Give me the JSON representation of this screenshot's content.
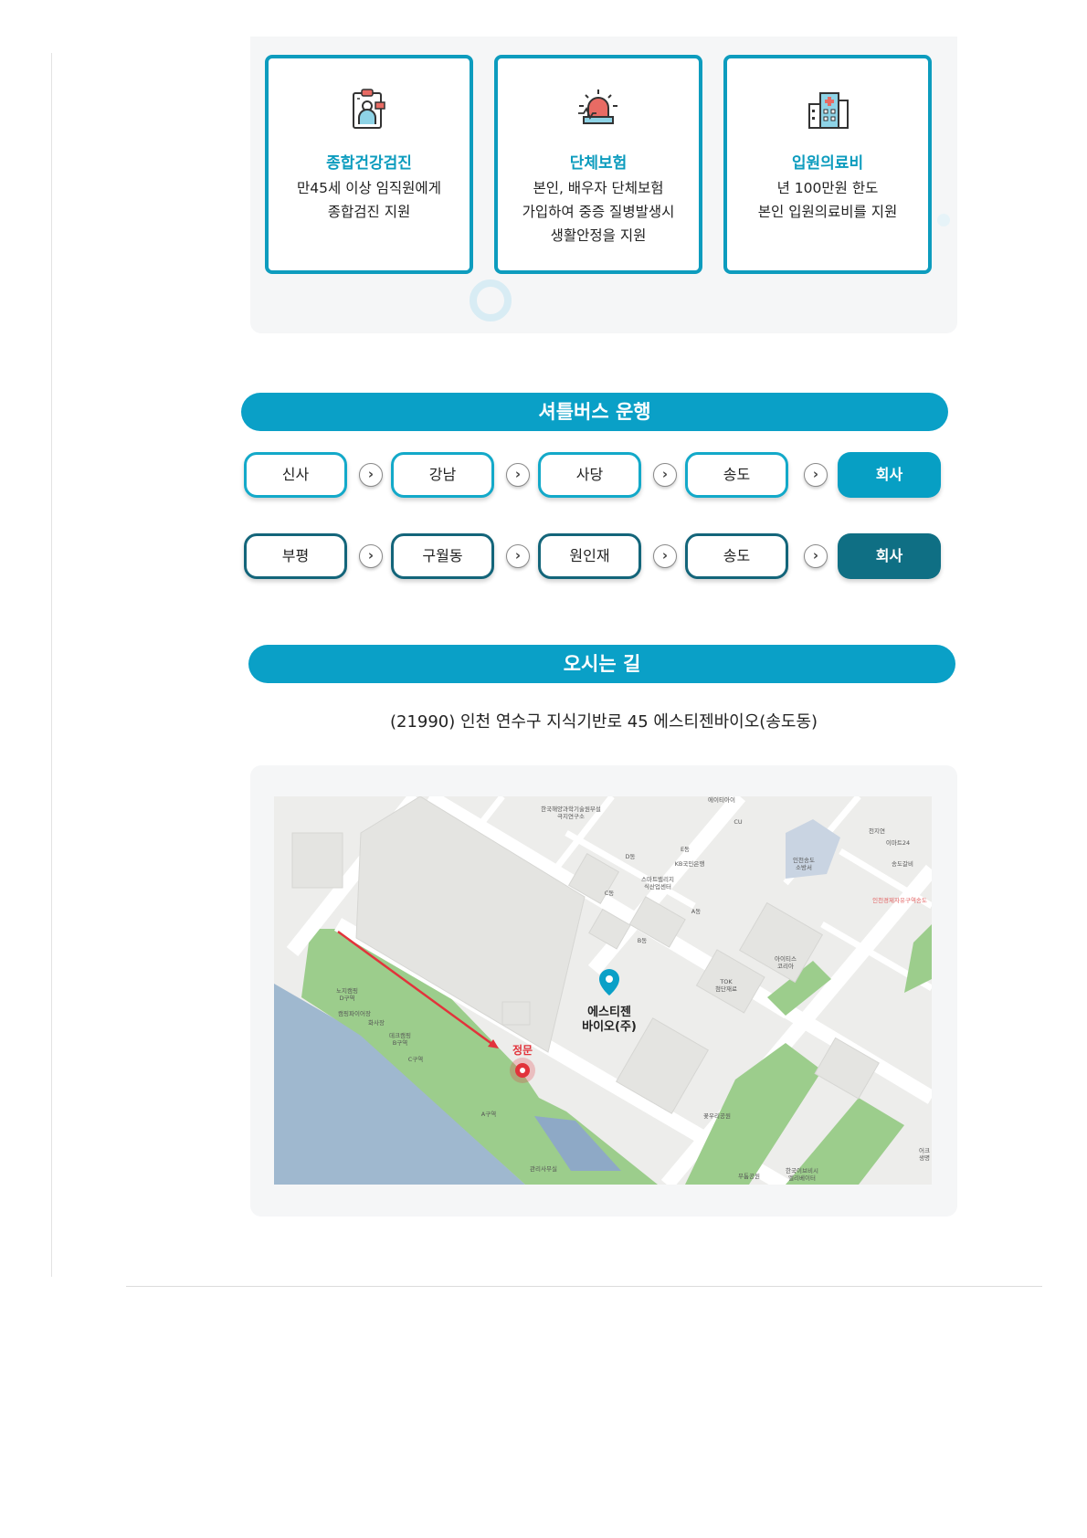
{
  "benefits": [
    {
      "icon": "medical-checkup-icon",
      "title": "종합건강검진",
      "lines": [
        "만45세 이상 임직원에게",
        "종합검진 지원"
      ]
    },
    {
      "icon": "emergency-insurance-icon",
      "title": "단체보험",
      "lines": [
        "본인, 배우자 단체보험",
        "가입하여 중증 질병발생시",
        "생활안정을 지원"
      ]
    },
    {
      "icon": "hospital-icon",
      "title": "입원의료비",
      "lines": [
        "년 100만원 한도",
        "본인 입원의료비를 지원"
      ]
    }
  ],
  "shuttle": {
    "title": "셔틀버스 운행",
    "routes": [
      [
        "신사",
        "강남",
        "사당",
        "송도",
        "회사"
      ],
      [
        "부평",
        "구월동",
        "원인재",
        "송도",
        "회사"
      ]
    ],
    "arrow": "›"
  },
  "directions": {
    "title": "오시는 길",
    "address": "(21990) 인천 연수구 지식기반로 45 에스티젠바이오(송도동)"
  },
  "map": {
    "marker_name_line1": "에스티젠",
    "marker_name_line2": "바이오(주)",
    "gate_label": "정문",
    "labels": {
      "l1": "한국해양과학기술원부설",
      "l2": "극지연구소",
      "l3": "에이티아이",
      "l4": "CU",
      "l5": "E동",
      "l6": "D동",
      "l7": "KB국민은행",
      "l8": "스마트밸리지",
      "l9": "식산업센터",
      "l10": "C동",
      "l11": "A동",
      "l12": "B동",
      "l13": "인천송도",
      "l14": "소방서",
      "l15": "천지연",
      "l16": "이마트24",
      "l17": "송도갈비",
      "l18": "인천경제자유구역송도",
      "l19": "아이티스",
      "l20": "코리아",
      "l21": "TOK",
      "l22": "첨단재료",
      "l23": "노지캠핑",
      "l24": "D구역",
      "l25": "캠핑파이어장",
      "l26": "화사장",
      "l27": "데크캠핑",
      "l28": "B구역",
      "l29": "C구역",
      "l30": "A구역",
      "l31": "관리사무실",
      "l32": "꽃우리공원",
      "l33": "무툼공원",
      "l34": "한국이브비시",
      "l35": "엘리베이터",
      "l36": "어크",
      "l37": "생명"
    }
  },
  "colors": {
    "accent": "#0aa0c7",
    "dark": "#0f6f84",
    "gate": "#e2333b"
  }
}
